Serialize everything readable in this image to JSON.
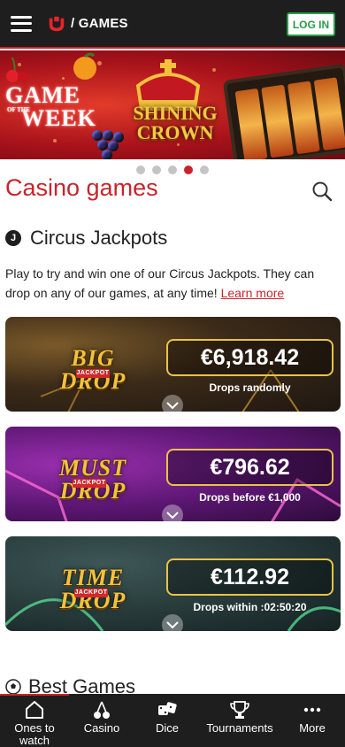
{
  "header": {
    "section": "/ GAMES",
    "login_label": "LOG IN"
  },
  "banner": {
    "small_label": "OF THE",
    "game_word": "GAME",
    "week_word": "WEEK",
    "title_line1": "SHINING",
    "title_line2": "CROWN"
  },
  "carousel": {
    "count": 5,
    "active_index": 3
  },
  "page": {
    "title": "Casino games"
  },
  "jackpots": {
    "badge": "J",
    "heading": "Circus Jackpots",
    "description": "Play to try and win one of our Circus Jackpots. They can drop on any of our games, at any time!",
    "learn_more": "Learn more",
    "cards": [
      {
        "logo": "BIG DROP",
        "tag": "JACKPOT",
        "amount": "€6,918.42",
        "subtitle": "Drops randomly"
      },
      {
        "logo": "MUST DROP",
        "tag": "JACKPOT",
        "amount": "€796.62",
        "subtitle": "Drops before €1,000"
      },
      {
        "logo": "TIME DROP",
        "tag": "JACKPOT",
        "amount": "€112.92",
        "subtitle": "Drops within :02:50:20"
      }
    ]
  },
  "best_games": {
    "heading": "Best Games"
  },
  "nav": {
    "items": [
      {
        "label": "Ones to watch",
        "icon": "home-icon"
      },
      {
        "label": "Casino",
        "icon": "cherries-icon"
      },
      {
        "label": "Dice",
        "icon": "dice-icon"
      },
      {
        "label": "Tournaments",
        "icon": "trophy-icon"
      },
      {
        "label": "More",
        "icon": "more-dots-icon"
      }
    ]
  },
  "colors": {
    "brand_red": "#c8242b",
    "header_bg": "#1e1e1e",
    "login_green": "#2a9d4a",
    "gold": "#e9c34a"
  }
}
